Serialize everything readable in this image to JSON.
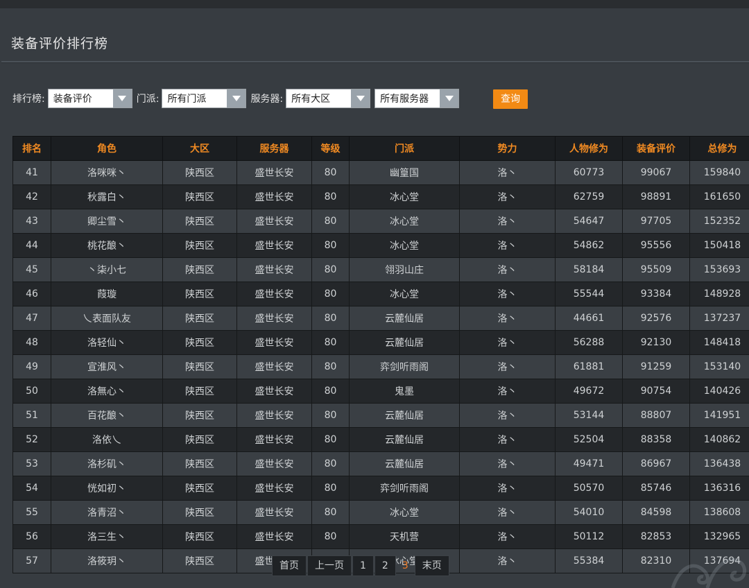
{
  "page": {
    "title": "装备评价排行榜"
  },
  "filters": {
    "rank_label": "排行榜:",
    "rank_value": "装备评价",
    "faction_label": "门派:",
    "faction_value": "所有门派",
    "server_label": "服务器:",
    "region_value": "所有大区",
    "server_value": "所有服务器",
    "search_label": "查询"
  },
  "table": {
    "headers": [
      "排名",
      "角色",
      "大区",
      "服务器",
      "等级",
      "门派",
      "势力",
      "人物修为",
      "装备评价",
      "总修为"
    ],
    "rows": [
      [
        "41",
        "洛咪咪丶",
        "陕西区",
        "盛世长安",
        "80",
        "幽篁国",
        "洛丶",
        "60773",
        "99067",
        "159840"
      ],
      [
        "42",
        "秋露白丶",
        "陕西区",
        "盛世长安",
        "80",
        "冰心堂",
        "洛丶",
        "62759",
        "98891",
        "161650"
      ],
      [
        "43",
        "卿尘雪丶",
        "陕西区",
        "盛世长安",
        "80",
        "冰心堂",
        "洛丶",
        "54647",
        "97705",
        "152352"
      ],
      [
        "44",
        "桃花酿丶",
        "陕西区",
        "盛世长安",
        "80",
        "冰心堂",
        "洛丶",
        "54862",
        "95556",
        "150418"
      ],
      [
        "45",
        "丶柒小七",
        "陕西区",
        "盛世长安",
        "80",
        "翎羽山庄",
        "洛丶",
        "58184",
        "95509",
        "153693"
      ],
      [
        "46",
        "葭璇",
        "陕西区",
        "盛世长安",
        "80",
        "冰心堂",
        "洛丶",
        "55544",
        "93384",
        "148928"
      ],
      [
        "47",
        "乀表面队友",
        "陕西区",
        "盛世长安",
        "80",
        "云麓仙居",
        "洛丶",
        "44661",
        "92576",
        "137237"
      ],
      [
        "48",
        "洛轻仙丶",
        "陕西区",
        "盛世长安",
        "80",
        "云麓仙居",
        "洛丶",
        "56288",
        "92130",
        "148418"
      ],
      [
        "49",
        "宣淮风丶",
        "陕西区",
        "盛世长安",
        "80",
        "弈剑听雨阁",
        "洛丶",
        "61881",
        "91259",
        "153140"
      ],
      [
        "50",
        "洛無心丶",
        "陕西区",
        "盛世长安",
        "80",
        "鬼墨",
        "洛丶",
        "49672",
        "90754",
        "140426"
      ],
      [
        "51",
        "百花酿丶",
        "陕西区",
        "盛世长安",
        "80",
        "云麓仙居",
        "洛丶",
        "53144",
        "88807",
        "141951"
      ],
      [
        "52",
        "洛依乀",
        "陕西区",
        "盛世长安",
        "80",
        "云麓仙居",
        "洛丶",
        "52504",
        "88358",
        "140862"
      ],
      [
        "53",
        "洛杉矶丶",
        "陕西区",
        "盛世长安",
        "80",
        "云麓仙居",
        "洛丶",
        "49471",
        "86967",
        "136438"
      ],
      [
        "54",
        "恍如初丶",
        "陕西区",
        "盛世长安",
        "80",
        "弈剑听雨阁",
        "洛丶",
        "50570",
        "85746",
        "136316"
      ],
      [
        "55",
        "洛青沼丶",
        "陕西区",
        "盛世长安",
        "80",
        "冰心堂",
        "洛丶",
        "54010",
        "84598",
        "138608"
      ],
      [
        "56",
        "洛三生丶",
        "陕西区",
        "盛世长安",
        "80",
        "天机营",
        "洛丶",
        "50112",
        "82853",
        "132965"
      ],
      [
        "57",
        "洛筱玥丶",
        "陕西区",
        "盛世长安",
        "80",
        "冰心堂",
        "洛丶",
        "55384",
        "82310",
        "137694"
      ]
    ]
  },
  "pager": {
    "first": "首页",
    "prev": "上一页",
    "pages": [
      "1",
      "2",
      "3"
    ],
    "current": "3",
    "last": "末页"
  },
  "colors": {
    "accent": "#f08a22",
    "search_button": "#f28a14",
    "header_bg": "#1b1e21"
  }
}
